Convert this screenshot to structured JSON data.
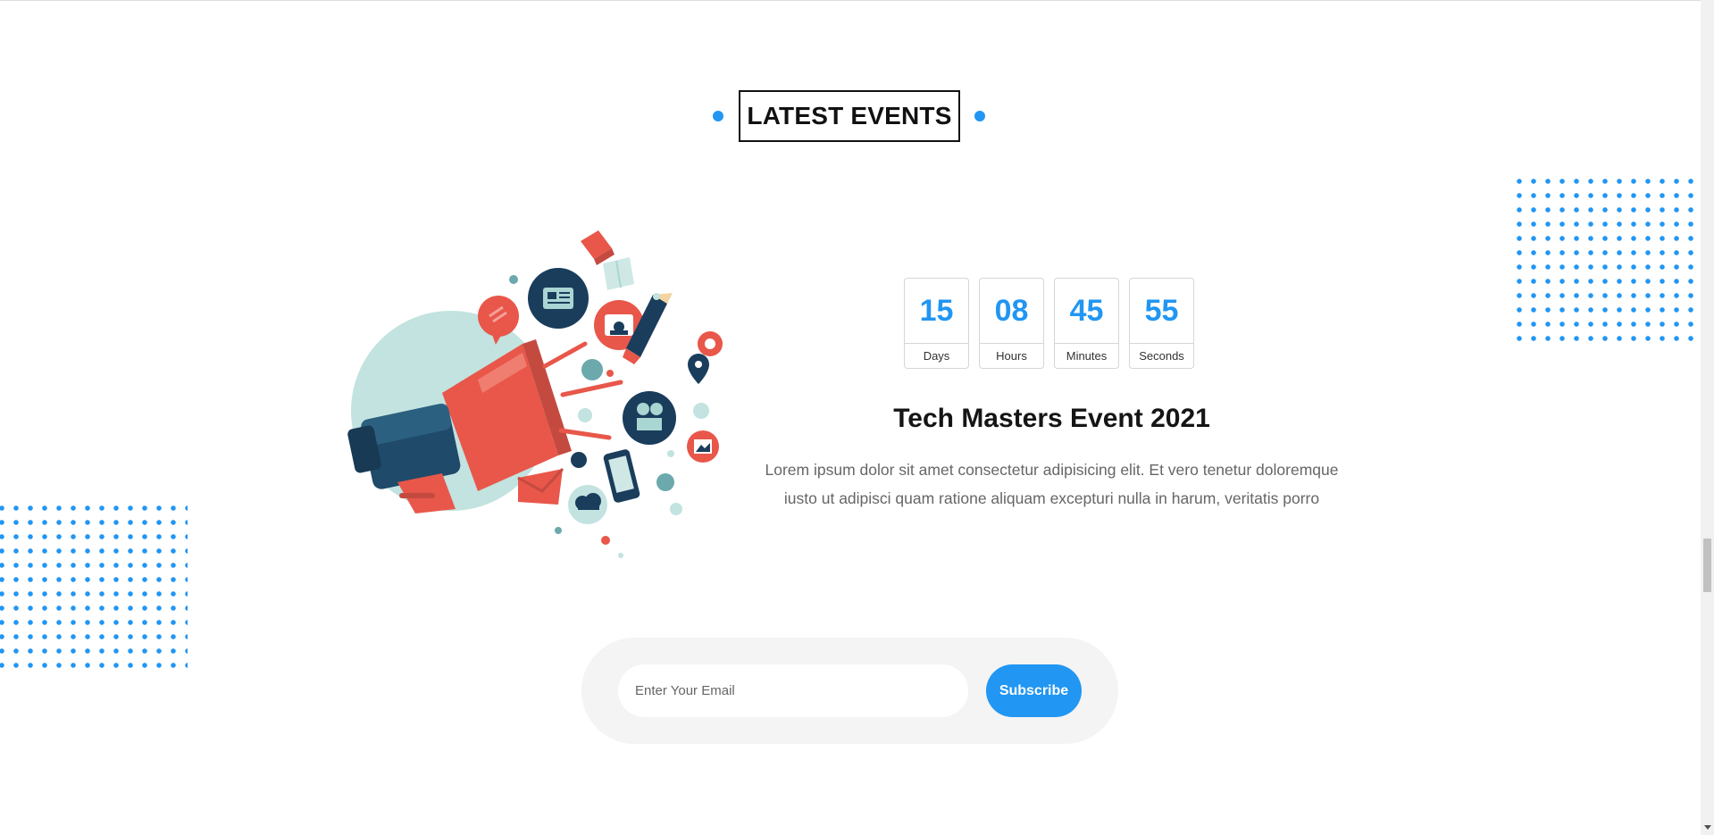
{
  "section": {
    "heading": "LATEST EVENTS",
    "accent_color": "#2196f3"
  },
  "illustration": {
    "icon": "megaphone-illustration-icon"
  },
  "countdown": [
    {
      "value": "15",
      "label": "Days"
    },
    {
      "value": "08",
      "label": "Hours"
    },
    {
      "value": "45",
      "label": "Minutes"
    },
    {
      "value": "55",
      "label": "Seconds"
    }
  ],
  "event": {
    "title": "Tech Masters Event 2021",
    "description": "Lorem ipsum dolor sit amet consectetur adipisicing elit. Et vero tenetur doloremque iusto ut adipisci quam ratione aliquam excepturi nulla in harum, veritatis porro"
  },
  "subscribe": {
    "email_placeholder": "Enter Your Email",
    "email_value": "",
    "button_label": "Subscribe"
  },
  "scrollbar": {
    "position_fraction": 0.66
  }
}
